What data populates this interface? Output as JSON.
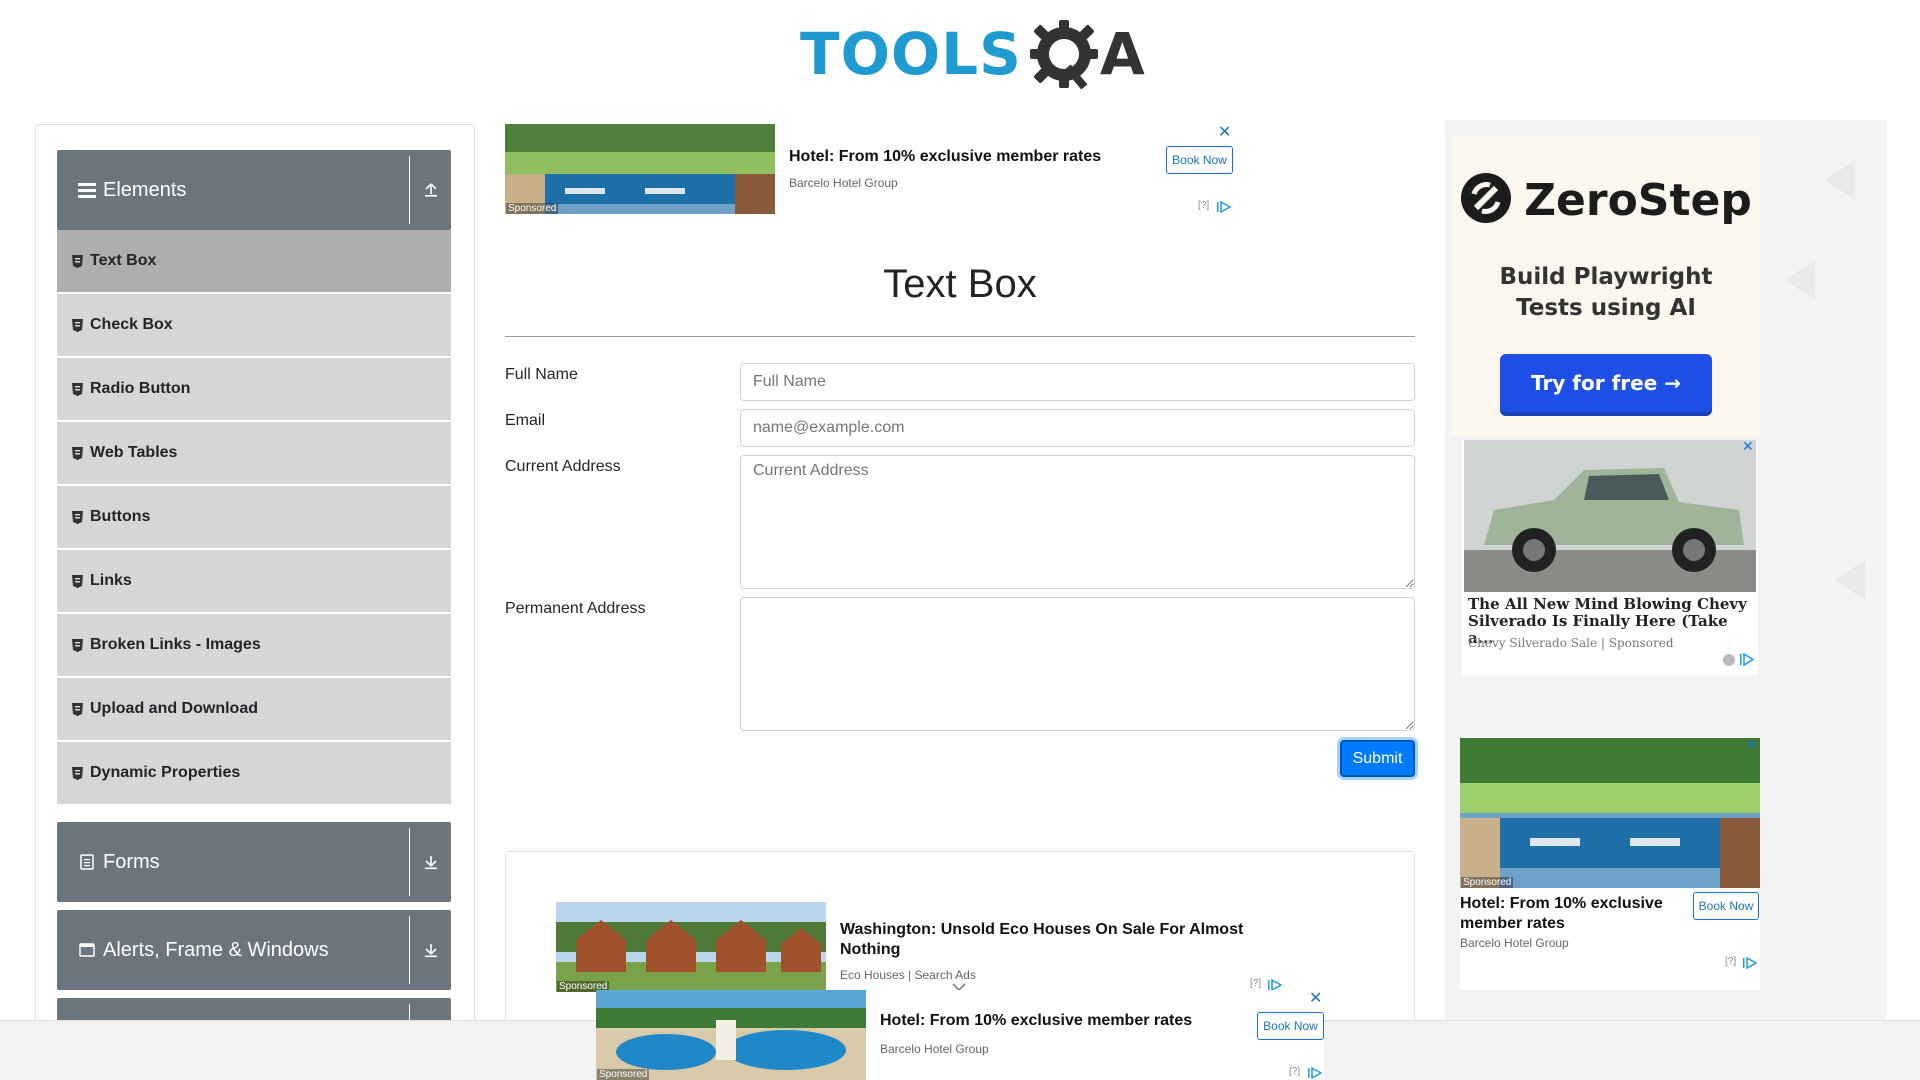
{
  "logo": {
    "text_tools": "TOOLS",
    "text_qa_a": "A",
    "alt": "TOOLSQA"
  },
  "sidebar": {
    "groups": [
      {
        "title": "Elements",
        "icon": "menu-icon",
        "toggle_icon": "collapse-up-icon"
      },
      {
        "title": "Forms",
        "icon": "document-icon",
        "toggle_icon": "expand-down-icon"
      },
      {
        "title": "Alerts, Frame & Windows",
        "icon": "window-icon",
        "toggle_icon": "expand-down-icon"
      }
    ],
    "items": [
      {
        "label": "Text Box",
        "active": true
      },
      {
        "label": "Check Box"
      },
      {
        "label": "Radio Button"
      },
      {
        "label": "Web Tables"
      },
      {
        "label": "Buttons"
      },
      {
        "label": "Links"
      },
      {
        "label": "Broken Links - Images"
      },
      {
        "label": "Upload and Download"
      },
      {
        "label": "Dynamic Properties"
      }
    ]
  },
  "top_ad": {
    "title": "Hotel: From 10% exclusive member rates",
    "advertiser": "Barcelo Hotel Group",
    "cta": "Book Now",
    "sponsored": "Sponsored",
    "info": "[?]",
    "close": "✕"
  },
  "main": {
    "title": "Text Box",
    "fields": {
      "full_name_label": "Full Name",
      "full_name_placeholder": "Full Name",
      "email_label": "Email",
      "email_placeholder": "name@example.com",
      "current_address_label": "Current Address",
      "current_address_placeholder": "Current Address",
      "permanent_address_label": "Permanent Address",
      "permanent_address_placeholder": ""
    },
    "submit_label": "Submit"
  },
  "inline_ad": {
    "title": "Washington: Unsold Eco Houses On Sale For Almost Nothing",
    "advertiser": "Eco Houses | Search Ads",
    "sponsored": "Sponsored",
    "info": "[?]"
  },
  "right_ads": {
    "zerostep": {
      "name": "ZeroStep",
      "tagline_line1": "Build Playwright",
      "tagline_line2": "Tests using AI",
      "cta": "Try for free →"
    },
    "chevy": {
      "title": "The All New Mind Blowing Chevy Silverado Is Finally Here (Take a...",
      "advertiser": "Chevy Silverado Sale | Sponsored",
      "close": "✕"
    },
    "hotel": {
      "title": "Hotel: From 10% exclusive member rates",
      "advertiser": "Barcelo Hotel Group",
      "cta": "Book Now",
      "sponsored": "Sponsored",
      "info": "[?]",
      "close": "✕"
    }
  },
  "bottom_ad": {
    "title": "Hotel: From 10% exclusive member rates",
    "advertiser": "Barcelo Hotel Group",
    "cta": "Book Now",
    "sponsored": "Sponsored",
    "info": "[?]",
    "close": "✕"
  },
  "colors": {
    "brand_blue": "#1f9bd1",
    "sidebar_header": "#6c757d",
    "menu_item": "#d6d6d6",
    "menu_item_active": "#aeaeae",
    "submit": "#007bff"
  }
}
